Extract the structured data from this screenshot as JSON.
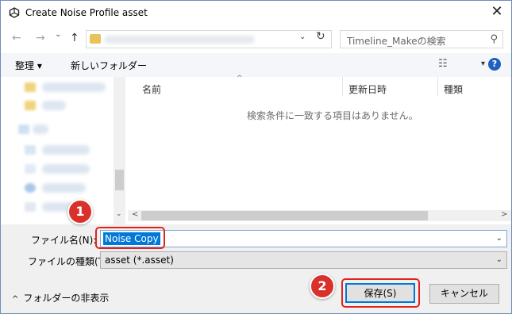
{
  "window": {
    "title": "Create Noise Profile asset",
    "close": "✕"
  },
  "nav": {
    "back": "←",
    "forward": "→",
    "recent": "⌄",
    "up": "↑",
    "address_drop": "⌄",
    "refresh": "↻",
    "search_placeholder": "Timeline_Makeの検索",
    "search_icon": "⚲"
  },
  "toolbar": {
    "organize": "整理 ▾",
    "new_folder": "新しいフォルダー",
    "view_icon": "☷",
    "view_drop": "▾",
    "help": "?"
  },
  "navpane": {
    "down_arrow": "⌄"
  },
  "list": {
    "columns": [
      "名前",
      "更新日時",
      "種類"
    ],
    "sort_indicator": "^",
    "empty_message": "検索条件に一致する項目はありません。",
    "scroll_left": "<",
    "scroll_right": ">"
  },
  "form": {
    "filename_label": "ファイル名(N):",
    "filename_value": "Noise Copy",
    "filetype_label": "ファイルの種類(T):",
    "filetype_value": "asset (*.asset)",
    "drop": "⌄"
  },
  "footer": {
    "hide_folders": "フォルダーの非表示",
    "chevron": "^",
    "save": "保存(S)",
    "cancel": "キャンセル"
  },
  "annotations": {
    "badge1": "1",
    "badge2": "2",
    "color": "#e0241d"
  }
}
